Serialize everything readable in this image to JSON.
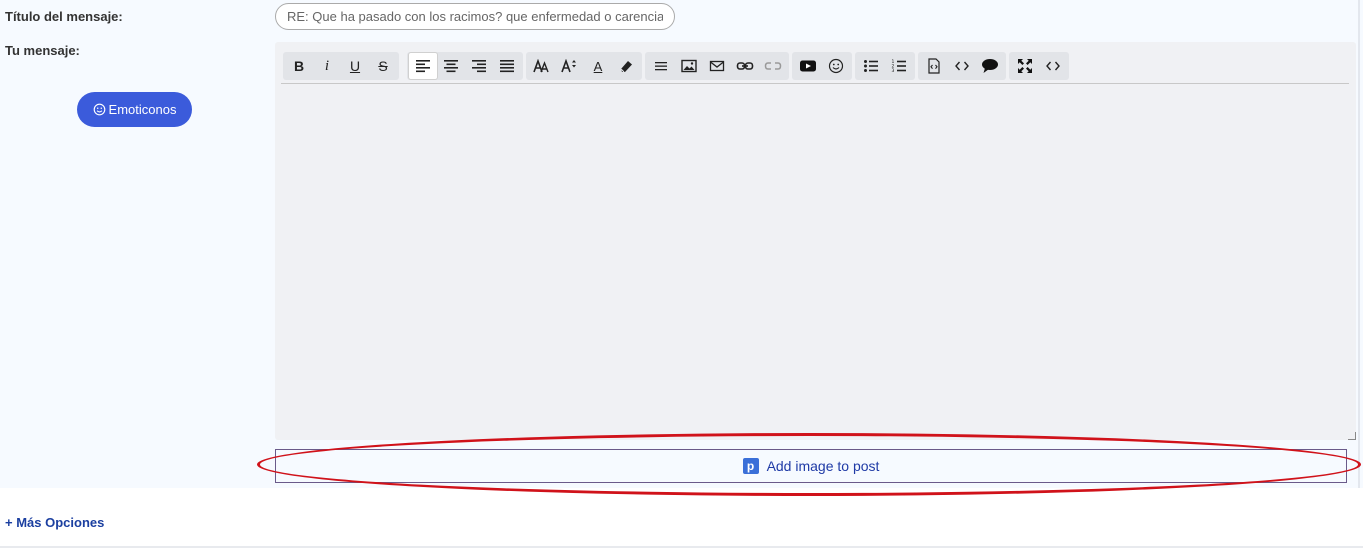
{
  "form": {
    "title_label": "Título del mensaje:",
    "title_placeholder": "RE: Que ha pasado con los racimos? que enfermedad o carencia?",
    "title_value": "",
    "message_label": "Tu mensaje:",
    "emoticons_label": "Emoticonos",
    "message_value": ""
  },
  "toolbar": {
    "groups": [
      [
        "bold-icon",
        "italic-icon",
        "underline-icon",
        "strikethrough-icon"
      ],
      [
        "align-left-icon",
        "align-center-icon",
        "align-right-icon",
        "align-justify-icon"
      ],
      [
        "font-face-icon",
        "font-size-icon",
        "font-color-icon",
        "eraser-icon"
      ],
      [
        "horizontal-rule-icon",
        "image-icon",
        "email-icon",
        "link-icon",
        "unlink-icon"
      ],
      [
        "youtube-icon",
        "emoticon-icon"
      ],
      [
        "bullet-list-icon",
        "numbered-list-icon"
      ],
      [
        "code-icon",
        "inline-code-icon",
        "quote-icon"
      ],
      [
        "maximize-icon",
        "source-icon"
      ]
    ],
    "bold_glyph": "B",
    "italic_glyph": "i",
    "underline_glyph": "U",
    "strike_glyph": "S",
    "font_color_glyph": "A",
    "active": "align-left-icon",
    "disabled": [
      "unlink-icon"
    ]
  },
  "add_image": {
    "label": "Add image to post",
    "icon": "postimage-p-icon",
    "icon_glyph": "p"
  },
  "more_options_label": "+ Más Opciones",
  "colors": {
    "panel_bg": "#f6faff",
    "emoticons_bg": "#3b5bdb",
    "link": "#1b3fa0",
    "annotation": "#d0121a"
  }
}
